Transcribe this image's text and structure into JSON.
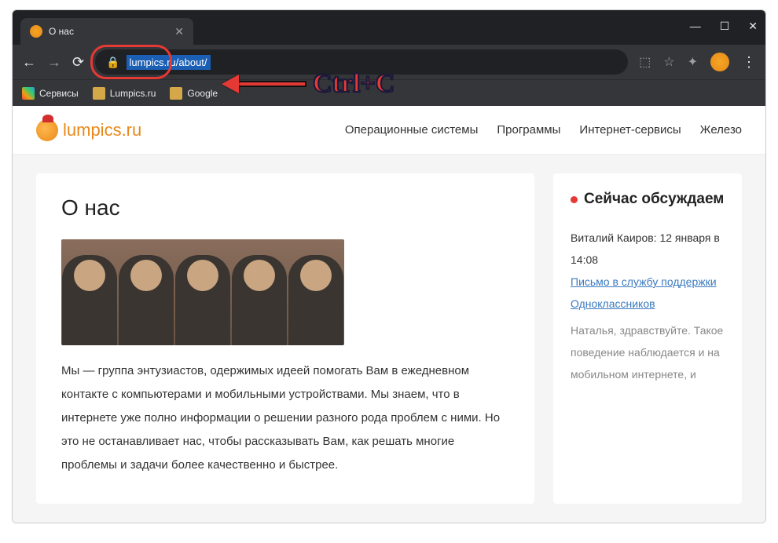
{
  "window": {
    "tab_title": "О нас",
    "url": "lumpics.ru/about/"
  },
  "bookmarks": {
    "apps": "Сервисы",
    "lumpics": "Lumpics.ru",
    "google": "Google"
  },
  "annotation": {
    "label": "Ctrl+C"
  },
  "site": {
    "logo_text": "lumpics.ru",
    "nav": {
      "os": "Операционные системы",
      "programs": "Программы",
      "services": "Интернет-сервисы",
      "hardware": "Железо"
    }
  },
  "article": {
    "title": "О нас",
    "body": "Мы — группа энтузиастов, одержимых идеей помогать Вам в ежедневном контакте с компьютерами и мобильными устройствами. Мы знаем, что в интернете уже полно информации о решении разного рода проблем с ними. Но это не останавливает нас, чтобы рассказывать Вам, как решать многие проблемы и задачи более качественно и быстрее."
  },
  "sidebar": {
    "heading": "Сейчас обсуждаем",
    "comment_author": "Виталий Каиров: 12 января в 14:08",
    "comment_link": "Письмо в службу поддержки Одноклассников",
    "comment_body": "Наталья, здравствуйте. Такое поведение наблюдается и на мобильном интернете, и"
  }
}
